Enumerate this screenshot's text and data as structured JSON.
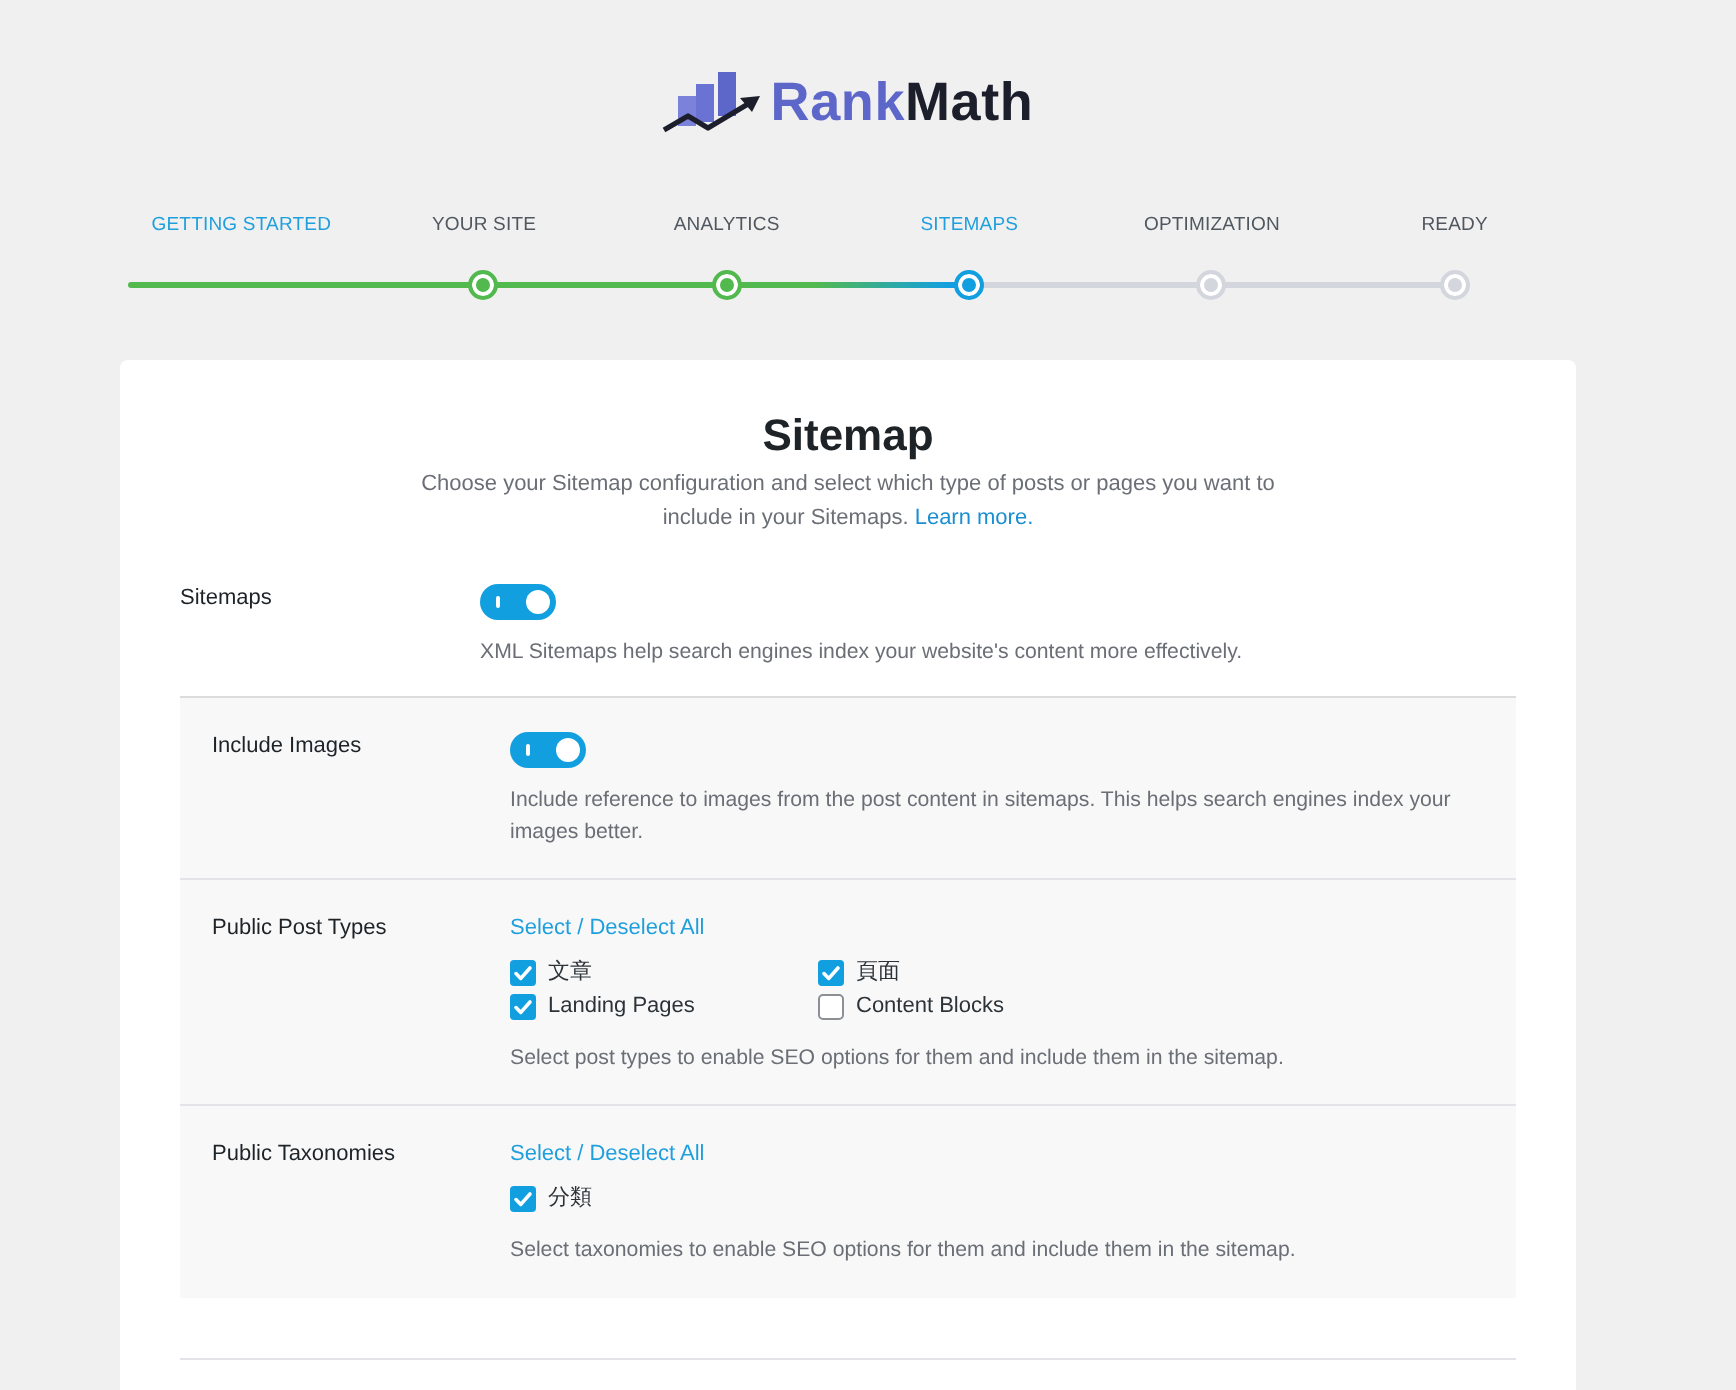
{
  "logo": {
    "parts": [
      {
        "text": "Rank",
        "color": "#5d66c9"
      },
      {
        "text": "Math",
        "color": "#1c1e2b"
      }
    ]
  },
  "steps": [
    {
      "label": "GETTING STARTED",
      "kind": "start",
      "selected": false
    },
    {
      "label": "YOUR SITE",
      "kind": "step",
      "selected": false
    },
    {
      "label": "ANALYTICS",
      "kind": "step",
      "selected": false
    },
    {
      "label": "SITEMAPS",
      "kind": "step",
      "selected": true
    },
    {
      "label": "OPTIMIZATION",
      "kind": "step",
      "selected": false
    },
    {
      "label": "READY",
      "kind": "step",
      "selected": false
    }
  ],
  "card": {
    "title": "Sitemap",
    "description": "Choose your Sitemap configuration and select which type of posts or pages you want to include in your Sitemaps.",
    "learn_more": "Learn more."
  },
  "settings": [
    {
      "kind": "toggle",
      "label": "Sitemaps",
      "on": true,
      "description": "XML Sitemaps help search engines index your website's content more effectively."
    }
  ],
  "sub_settings": [
    {
      "kind": "toggle",
      "label": "Include Images",
      "on": true,
      "description": "Include reference to images from the post content in sitemaps. This helps search engines index your images better."
    },
    {
      "kind": "checkboxes",
      "label": "Public Post Types",
      "select_all": "Select / Deselect All",
      "options": [
        {
          "label": "文章",
          "checked": true
        },
        {
          "label": "頁面",
          "checked": true
        },
        {
          "label": "Landing Pages",
          "checked": true
        },
        {
          "label": "Content Blocks",
          "checked": false
        }
      ],
      "description": "Select post types to enable SEO options for them and include them in the sitemap."
    },
    {
      "kind": "checkboxes",
      "label": "Public Taxonomies",
      "select_all": "Select / Deselect All",
      "options": [
        {
          "label": "分類",
          "checked": true
        }
      ],
      "description": "Select taxonomies to enable SEO options for them and include them in the sitemap."
    }
  ]
}
